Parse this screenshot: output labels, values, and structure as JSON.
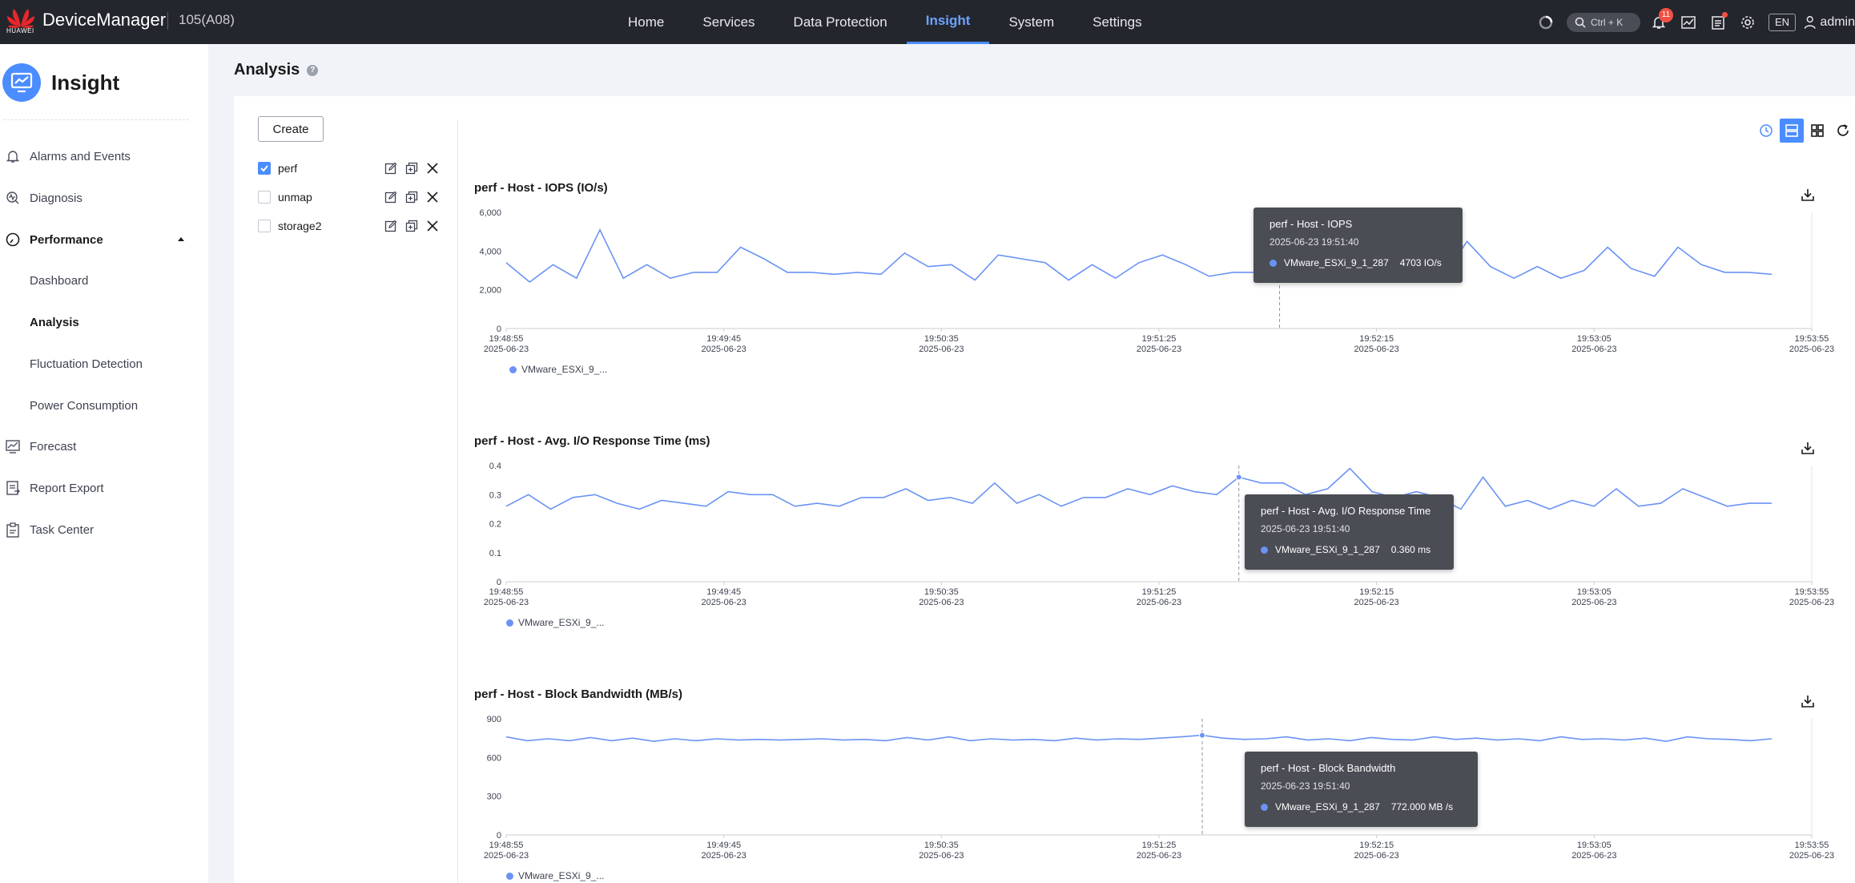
{
  "header": {
    "brand_label": "HUAWEI",
    "app_name": "DeviceManager",
    "device_id": "105(A08)",
    "nav": [
      {
        "label": "Home",
        "active": false
      },
      {
        "label": "Services",
        "active": false
      },
      {
        "label": "Data Protection",
        "active": false
      },
      {
        "label": "Insight",
        "active": true
      },
      {
        "label": "System",
        "active": false
      },
      {
        "label": "Settings",
        "active": false
      }
    ],
    "search_shortcut": "Ctrl + K",
    "notification_count": "11",
    "language": "EN",
    "user": "admin"
  },
  "sidebar": {
    "title": "Insight",
    "items": [
      {
        "label": "Alarms and Events",
        "icon": "bell-icon"
      },
      {
        "label": "Diagnosis",
        "icon": "diagnosis-icon"
      },
      {
        "label": "Performance",
        "icon": "gauge-icon",
        "expanded": true
      },
      {
        "label": "Forecast",
        "icon": "forecast-icon"
      },
      {
        "label": "Report Export",
        "icon": "report-icon"
      },
      {
        "label": "Task Center",
        "icon": "task-icon"
      }
    ],
    "performance_subitems": [
      {
        "label": "Dashboard",
        "active": false
      },
      {
        "label": "Analysis",
        "active": true
      },
      {
        "label": "Fluctuation Detection",
        "active": false
      },
      {
        "label": "Power Consumption",
        "active": false
      }
    ]
  },
  "page": {
    "title": "Analysis",
    "create_label": "Create",
    "analyses": [
      {
        "name": "perf",
        "checked": true
      },
      {
        "name": "unmap",
        "checked": false
      },
      {
        "name": "storage2",
        "checked": false
      }
    ]
  },
  "chart_data": [
    {
      "type": "line",
      "title": "perf - Host - IOPS (IO/s)",
      "yticks": [
        "6,000",
        "4,000",
        "2,000",
        "0"
      ],
      "ylim": [
        0,
        6000
      ],
      "xticks": [
        {
          "time": "19:48:55",
          "date": "2025-06-23"
        },
        {
          "time": "19:49:45",
          "date": "2025-06-23"
        },
        {
          "time": "19:50:35",
          "date": "2025-06-23"
        },
        {
          "time": "19:51:25",
          "date": "2025-06-23"
        },
        {
          "time": "19:52:15",
          "date": "2025-06-23"
        },
        {
          "time": "19:53:05",
          "date": "2025-06-23"
        },
        {
          "time": "19:53:55",
          "date": "2025-06-23"
        }
      ],
      "series": [
        {
          "name": "VMware_ESXi_9_1_287",
          "legend": "VMware_ESXi_9_...",
          "color": "#6b93f5",
          "values": [
            3400,
            2400,
            3300,
            2600,
            5100,
            2600,
            3300,
            2600,
            2900,
            2900,
            4200,
            3600,
            2900,
            2900,
            2800,
            2900,
            2800,
            3900,
            3200,
            3300,
            2500,
            3800,
            3600,
            3400,
            2500,
            3300,
            2600,
            3400,
            3800,
            3300,
            2700,
            2900,
            2900,
            4703,
            3100,
            3000,
            2800,
            3200,
            2700,
            2900,
            2700,
            4500,
            3200,
            2600,
            3200,
            2600,
            3000,
            4200,
            3100,
            2700,
            4200,
            3300,
            2900,
            2900,
            2800
          ]
        }
      ],
      "tooltip": {
        "title": "perf - Host - IOPS",
        "time": "2025-06-23 19:51:40",
        "series": "VMware_ESXi_9_1_287",
        "value": "4703 IO/s"
      }
    },
    {
      "type": "line",
      "title": "perf - Host - Avg. I/O Response Time (ms)",
      "yticks": [
        "0.4",
        "0.3",
        "0.2",
        "0.1",
        "0"
      ],
      "ylim": [
        0,
        0.4
      ],
      "xticks": [
        {
          "time": "19:48:55",
          "date": "2025-06-23"
        },
        {
          "time": "19:49:45",
          "date": "2025-06-23"
        },
        {
          "time": "19:50:35",
          "date": "2025-06-23"
        },
        {
          "time": "19:51:25",
          "date": "2025-06-23"
        },
        {
          "time": "19:52:15",
          "date": "2025-06-23"
        },
        {
          "time": "19:53:05",
          "date": "2025-06-23"
        },
        {
          "time": "19:53:55",
          "date": "2025-06-23"
        }
      ],
      "series": [
        {
          "name": "VMware_ESXi_9_1_287",
          "legend": "VMware_ESXi_9_...",
          "color": "#6b93f5",
          "values": [
            0.26,
            0.3,
            0.25,
            0.29,
            0.3,
            0.27,
            0.25,
            0.28,
            0.27,
            0.26,
            0.31,
            0.3,
            0.3,
            0.26,
            0.27,
            0.26,
            0.29,
            0.29,
            0.32,
            0.28,
            0.29,
            0.27,
            0.34,
            0.27,
            0.3,
            0.26,
            0.29,
            0.29,
            0.32,
            0.3,
            0.33,
            0.31,
            0.3,
            0.36,
            0.34,
            0.34,
            0.3,
            0.32,
            0.39,
            0.31,
            0.29,
            0.31,
            0.29,
            0.25,
            0.36,
            0.26,
            0.28,
            0.25,
            0.28,
            0.26,
            0.32,
            0.26,
            0.27,
            0.32,
            0.29,
            0.26,
            0.27,
            0.27
          ]
        }
      ],
      "tooltip": {
        "title": "perf - Host - Avg. I/O Response Time",
        "time": "2025-06-23 19:51:40",
        "series": "VMware_ESXi_9_1_287",
        "value": "0.360 ms"
      }
    },
    {
      "type": "line",
      "title": "perf - Host - Block Bandwidth (MB/s)",
      "yticks": [
        "900",
        "600",
        "300",
        "0"
      ],
      "ylim": [
        0,
        900
      ],
      "xticks": [
        {
          "time": "19:48:55",
          "date": "2025-06-23"
        },
        {
          "time": "19:49:45",
          "date": "2025-06-23"
        },
        {
          "time": "19:50:35",
          "date": "2025-06-23"
        },
        {
          "time": "19:51:25",
          "date": "2025-06-23"
        },
        {
          "time": "19:52:15",
          "date": "2025-06-23"
        },
        {
          "time": "19:53:05",
          "date": "2025-06-23"
        },
        {
          "time": "19:53:55",
          "date": "2025-06-23"
        }
      ],
      "series": [
        {
          "name": "VMware_ESXi_9_1_287",
          "legend": "VMware_ESXi_9_...",
          "color": "#6b93f5",
          "values": [
            760,
            730,
            745,
            730,
            755,
            730,
            750,
            725,
            745,
            730,
            745,
            735,
            740,
            735,
            740,
            745,
            735,
            740,
            730,
            755,
            735,
            760,
            730,
            745,
            735,
            740,
            730,
            750,
            735,
            745,
            740,
            750,
            760,
            772,
            750,
            740,
            745,
            760,
            735,
            745,
            730,
            755,
            740,
            735,
            760,
            740,
            750,
            735,
            745,
            730,
            760,
            740,
            745,
            735,
            750,
            725,
            760,
            745,
            740,
            730,
            745
          ]
        }
      ],
      "tooltip": {
        "title": "perf - Host - Block Bandwidth",
        "time": "2025-06-23 19:51:40",
        "series": "VMware_ESXi_9_1_287",
        "value": "772.000 MB /s"
      }
    }
  ]
}
